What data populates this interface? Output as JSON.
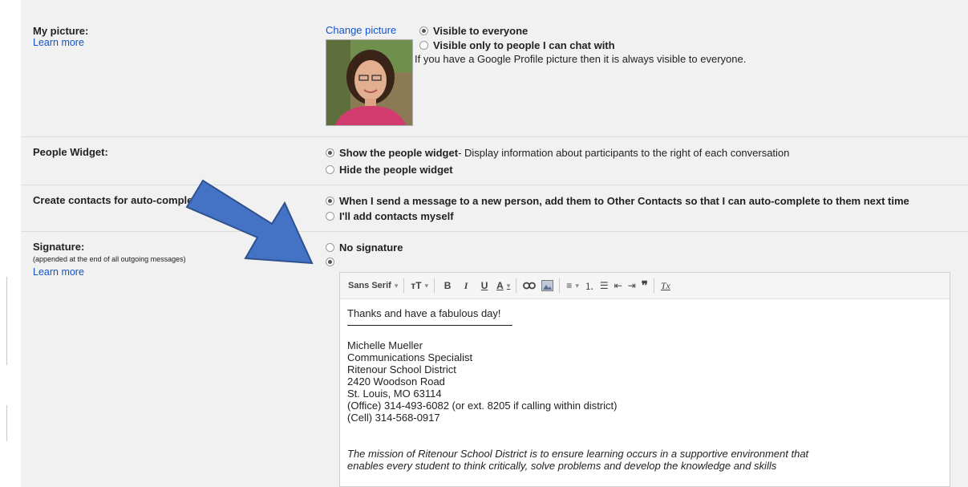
{
  "picture": {
    "label": "My picture:",
    "learn_more": "Learn more",
    "change": "Change picture",
    "opt1": "Visible to everyone",
    "opt2": "Visible only to people I can chat with",
    "note": "If you have a Google Profile picture then it is always visible to everyone."
  },
  "people_widget": {
    "label": "People Widget:",
    "opt1_bold": "Show the people widget",
    "opt1_rest": " - Display information about participants to the right of each conversation",
    "opt2": "Hide the people widget"
  },
  "contacts": {
    "label": "Create contacts for auto-complete:",
    "opt1": "When I send a message to a new person, add them to Other Contacts so that I can auto-complete to them next time",
    "opt2": "I'll add contacts myself"
  },
  "signature": {
    "label": "Signature:",
    "sub": "(appended at the end of all outgoing messages)",
    "learn_more": "Learn more",
    "opt1": "No signature",
    "font": "Sans Serif",
    "lines": {
      "l1": "Thanks and have a fabulous day!",
      "l2": "Michelle Mueller",
      "l3": "Communications Specialist",
      "l4": "Ritenour School District",
      "l5": "2420 Woodson Road",
      "l6": "St. Louis, MO 63114",
      "l7": "(Office) 314-493-6082 (or ext. 8205 if calling within district)",
      "l8": "(Cell) 314-568-0917",
      "mission1": "The mission of Ritenour School District is to ensure learning occurs in a supportive environment that",
      "mission2": "enables every student to think critically, solve problems and develop the knowledge and skills"
    }
  },
  "colors": {
    "link": "#1155cc",
    "arrow_fill": "#4472c4",
    "arrow_stroke": "#2f528f",
    "panel": "#f1f1f1"
  }
}
